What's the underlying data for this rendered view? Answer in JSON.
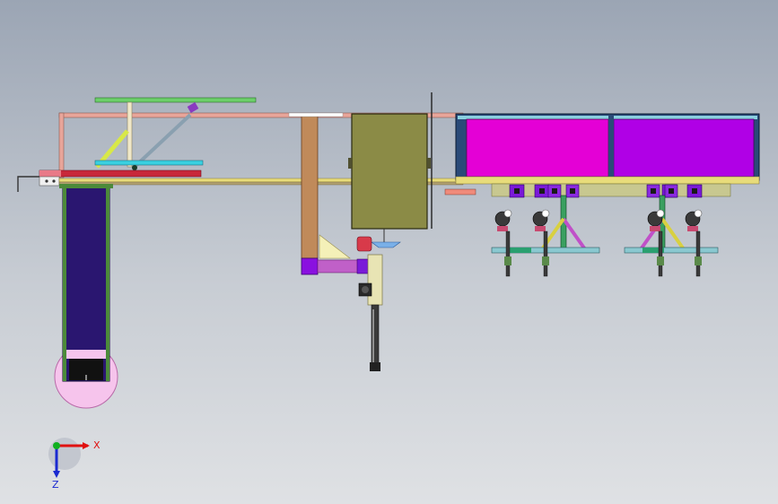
{
  "triad": {
    "x_label": "X",
    "z_label": "Z",
    "colors": {
      "x": "#e01010",
      "y": "#10b020",
      "z": "#1a2ad0"
    }
  },
  "colors": {
    "background_top": "#9ba5b4",
    "background_bottom": "#dfe1e4",
    "magenta_panel": "#e400d6",
    "violet_panel": "#b000e6",
    "olive_cabinet": "#8b8b46",
    "navy_column": "#2a1670",
    "pink_disc": "#f6c4ec",
    "frame_salmon": "#e8a59a",
    "tan_post": "#c08a5a"
  }
}
